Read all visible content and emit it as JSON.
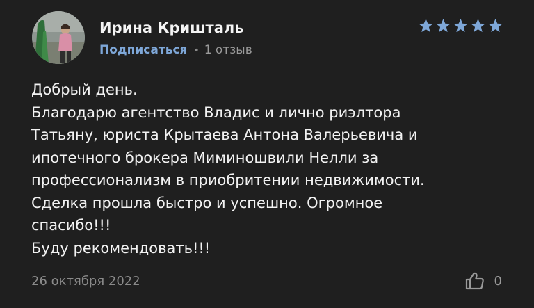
{
  "review": {
    "author_name": "Ирина Кришталь",
    "subscribe_label": "Подписаться",
    "separator": "•",
    "reviews_count": "1 отзыв",
    "rating": 5,
    "rating_max": 5,
    "star_color": "#7ea7d8",
    "lines": [
      "Добрый день.",
      "Благодарю агентство Владис и лично риэлтора",
      "Татьяну, юриста Крытаева Антона Валерьевича и",
      "ипотечного брокера Миминошвили Нелли за",
      "профессионализм в приобритении недвижимости.",
      "Сделка прошла быстро и успешно. Огромное",
      "спасибо!!!",
      "Буду рекомендовать!!!"
    ],
    "date": "26 октября 2022",
    "likes_count": "0",
    "like_icon": "thumbs-up-icon"
  }
}
